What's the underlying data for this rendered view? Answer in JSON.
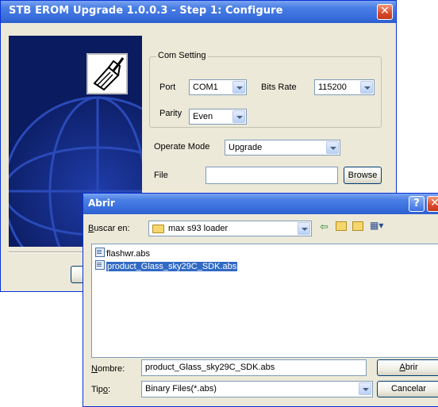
{
  "main_window": {
    "title": "STB EROM Upgrade 1.0.0.3 - Step 1: Configure",
    "close_label": "✕",
    "com_setting": {
      "group_label": "Com Setting",
      "port_label": "Port",
      "port_value": "COM1",
      "bits_rate_label": "Bits Rate",
      "bits_rate_value": "115200",
      "parity_label": "Parity",
      "parity_value": "Even"
    },
    "operate_mode_label": "Operate Mode",
    "operate_mode_value": "Upgrade",
    "file_label": "File",
    "file_value": "",
    "browse_label": "Browse"
  },
  "open_dialog": {
    "title": "Abrir",
    "help_label": "?",
    "close_label": "✕",
    "look_in_label_prefix": "B",
    "look_in_label_rest": "uscar en:",
    "look_in_value": "max s93 loader",
    "files": [
      {
        "name": "flashwr.abs",
        "selected": false
      },
      {
        "name": "product_Glass_sky29C_SDK.abs",
        "selected": true
      }
    ],
    "name_label_prefix": "N",
    "name_label_rest": "ombre:",
    "name_value": "product_Glass_sky29C_SDK.abs",
    "type_label_pre": "Tip",
    "type_label_u": "o",
    "type_label_post": ":",
    "type_value": "Binary Files(*.abs)",
    "open_button_prefix": "A",
    "open_button_rest": "brir",
    "cancel_button": "Cancelar"
  },
  "icons": {
    "banner": "rj45-connector-icon",
    "folder": "folder-icon",
    "back": "back-arrow-icon",
    "up": "up-folder-icon",
    "new_folder": "new-folder-icon",
    "views": "view-menu-icon",
    "file": "file-icon"
  },
  "colors": {
    "titlebar": "#3a6fdd",
    "window_bg": "#ece9d8",
    "selection": "#316ac5",
    "close": "#d8482a"
  }
}
